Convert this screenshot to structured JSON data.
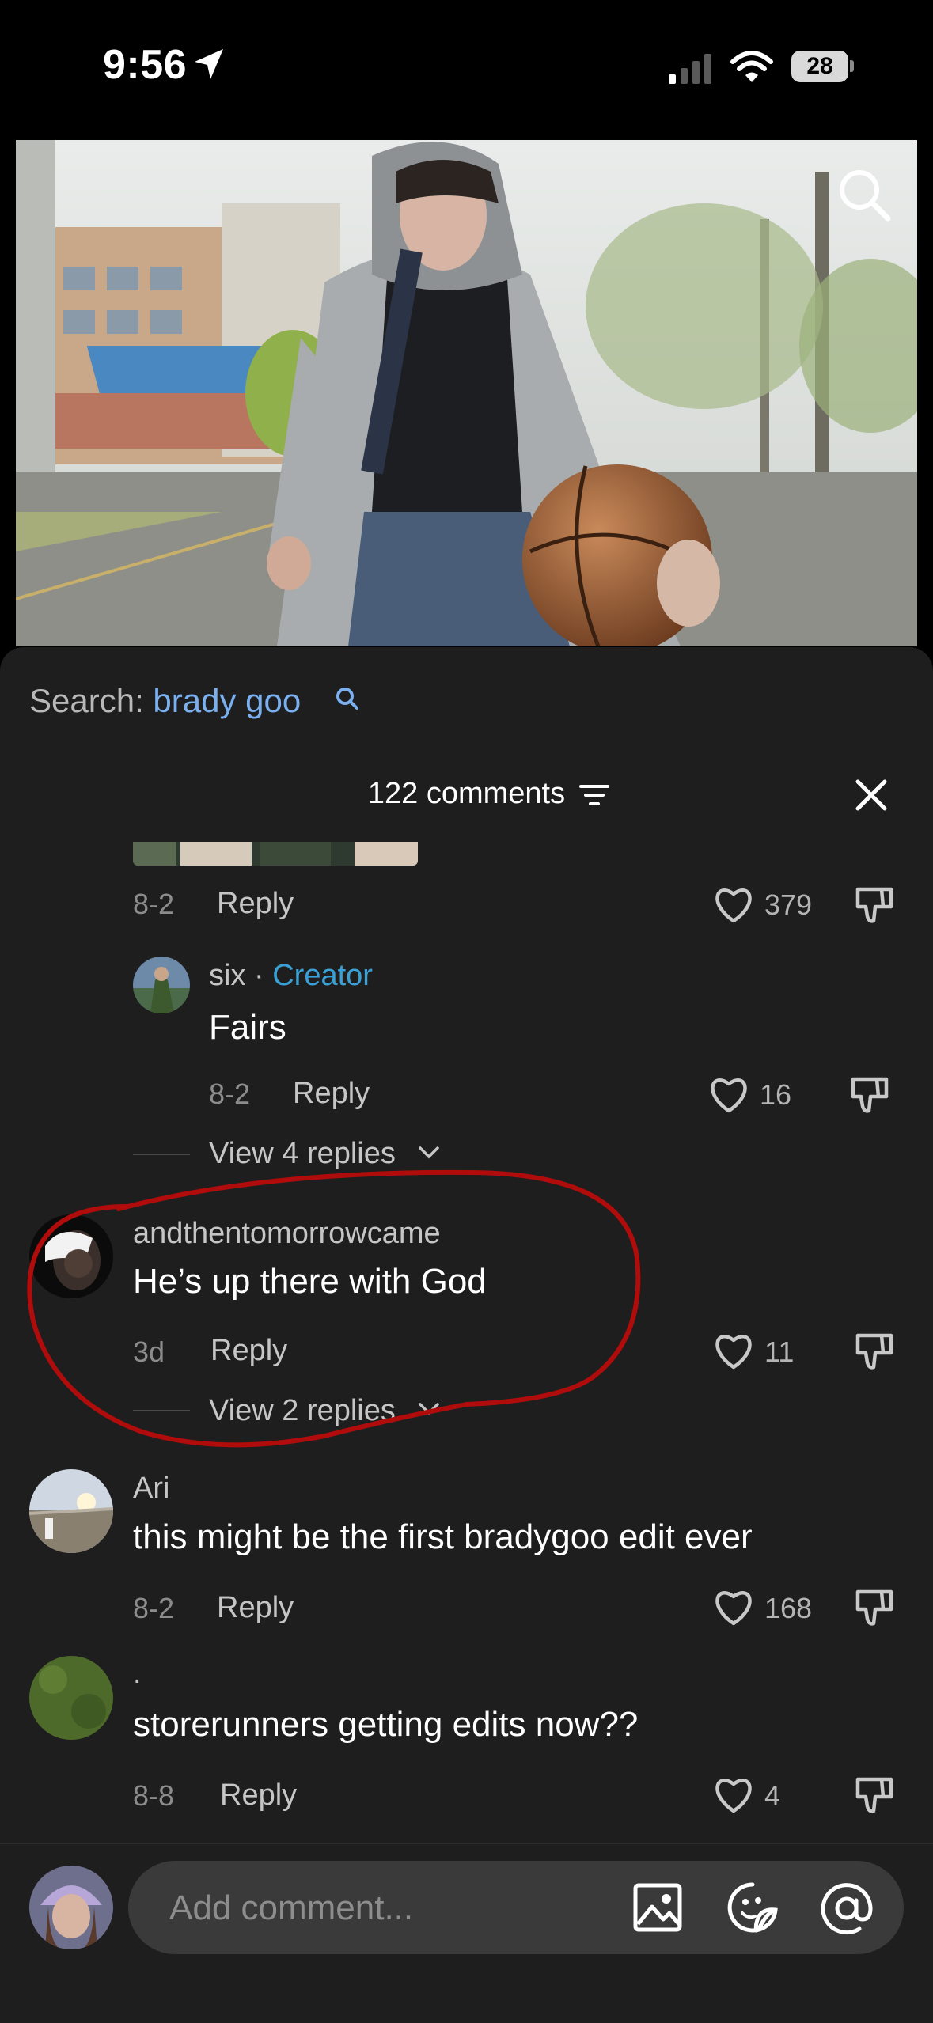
{
  "status_bar": {
    "time": "9:56",
    "battery": "28"
  },
  "sheet": {
    "search_prefix": "Search: ",
    "search_term": "brady goo",
    "comments_count": "122 comments"
  },
  "comments": [
    {
      "date": "8-2",
      "reply": "Reply",
      "likes": "379"
    },
    {
      "user": "six",
      "separator": " · ",
      "badge": "Creator",
      "text": "Fairs",
      "date": "8-2",
      "reply": "Reply",
      "likes": "16",
      "view_replies": "View 4 replies"
    },
    {
      "user": "andthentomorrowcame",
      "text": "He’s up there with God",
      "date": "3d",
      "reply": "Reply",
      "likes": "11",
      "view_replies": "View 2 replies"
    },
    {
      "user": "Ari",
      "text": "this might be the first bradygoo edit ever",
      "date": "8-2",
      "reply": "Reply",
      "likes": "168"
    },
    {
      "user": ".",
      "text": "storerunners getting edits now??",
      "date": "8-8",
      "reply": "Reply",
      "likes": "4"
    }
  ],
  "composer": {
    "placeholder": "Add comment..."
  },
  "colors": {
    "accent_blue": "#7ab0f0",
    "creator_blue": "#3aa0d6",
    "annotation_red": "#b00c0c"
  }
}
